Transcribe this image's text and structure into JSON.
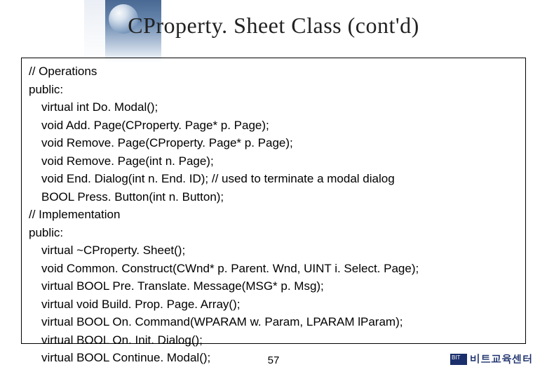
{
  "title": "CProperty. Sheet Class (cont'd)",
  "code": {
    "lines": [
      {
        "indent": 0,
        "text": "// Operations"
      },
      {
        "indent": 0,
        "text": "public:"
      },
      {
        "indent": 1,
        "text": "virtual int Do. Modal();"
      },
      {
        "indent": 1,
        "text": "void Add. Page(CProperty. Page* p. Page);"
      },
      {
        "indent": 1,
        "text": "void Remove. Page(CProperty. Page* p. Page);"
      },
      {
        "indent": 1,
        "text": "void Remove. Page(int n. Page);"
      },
      {
        "indent": 1,
        "text": "void End. Dialog(int n. End. ID); // used to terminate a modal dialog"
      },
      {
        "indent": 1,
        "text": "BOOL Press. Button(int n. Button);"
      },
      {
        "indent": 0,
        "text": "// Implementation"
      },
      {
        "indent": 0,
        "text": "public:"
      },
      {
        "indent": 1,
        "text": "virtual ~CProperty. Sheet();"
      },
      {
        "indent": 1,
        "text": "void Common. Construct(CWnd* p. Parent. Wnd, UINT i. Select. Page);"
      },
      {
        "indent": 1,
        "text": "virtual BOOL Pre. Translate. Message(MSG* p. Msg);"
      },
      {
        "indent": 1,
        "text": "virtual void Build. Prop. Page. Array();"
      },
      {
        "indent": 1,
        "text": "virtual BOOL On. Command(WPARAM w. Param, LPARAM lParam);"
      },
      {
        "indent": 1,
        "text": "virtual BOOL On. Init. Dialog();"
      },
      {
        "indent": 1,
        "text": "virtual BOOL Continue. Modal();"
      }
    ]
  },
  "page_number": "57",
  "footer": {
    "logo_text": "비트교육센터"
  }
}
